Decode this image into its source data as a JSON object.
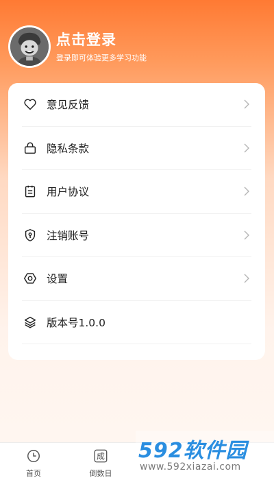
{
  "header": {
    "title": "点击登录",
    "subtitle": "登录即可体验更多学习功能",
    "avatar_icon": "cartoon-avatar-icon"
  },
  "menu": [
    {
      "label": "意见反馈",
      "icon": "heart-icon"
    },
    {
      "label": "隐私条款",
      "icon": "lock-icon"
    },
    {
      "label": "用户协议",
      "icon": "clipboard-icon"
    },
    {
      "label": "注销账号",
      "icon": "shield-key-icon"
    },
    {
      "label": "设置",
      "icon": "hexagon-settings-icon"
    },
    {
      "label": "版本号1.0.0",
      "icon": "layers-icon"
    }
  ],
  "tabbar": [
    {
      "label": "首页",
      "icon": "clock-icon"
    },
    {
      "label": "倒数日",
      "icon": "cheng-badge-icon",
      "glyph": "成"
    }
  ],
  "watermark": {
    "title": "592软件园",
    "url": "www.592xiazai.com"
  }
}
